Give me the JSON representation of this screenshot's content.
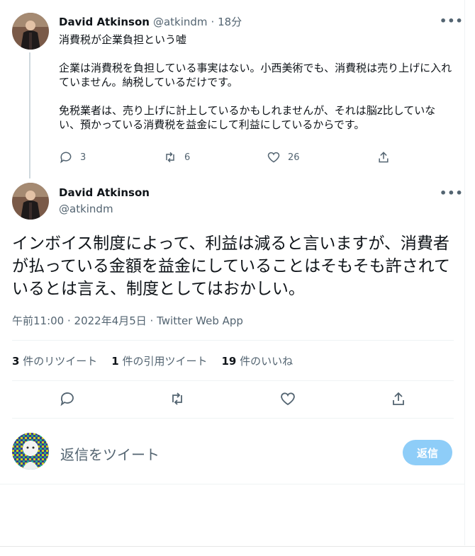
{
  "parent_tweet": {
    "name": "David Atkinson",
    "handle": "@atkindm",
    "time": "· 18分",
    "more": "•••",
    "text": "消費税が企業負担という嘘\n\n企業は消費税を負担している事実はない。小西美術でも、消費税は売り上げに入れていません。納税しているだけです。\n\n免税業者は、売り上げに計上しているかもしれませんが、それは脳z比していない、預かっている消費税を益金にして利益にしているからです。",
    "actions": {
      "reply_count": "3",
      "retweet_count": "6",
      "like_count": "26"
    }
  },
  "main_tweet": {
    "name": "David Atkinson",
    "handle": "@atkindm",
    "more": "•••",
    "text": "インボイス制度によって、利益は減ると言いますが、消費者が払っている金額を益金にしていることはそもそも許されているとは言え、制度としてはおかしい。",
    "meta": "午前11:00 · 2022年4月5日 · Twitter Web App",
    "stats": {
      "retweets_num": "3",
      "retweets_label": "件のリツイート",
      "quotes_num": "1",
      "quotes_label": "件の引用ツイート",
      "likes_num": "19",
      "likes_label": "件のいいね"
    }
  },
  "reply_box": {
    "placeholder": "返信をツイート",
    "button": "返信"
  },
  "colors": {
    "accent": "#1d9bf0",
    "reply_button": "#8ecdf8",
    "muted": "#536471"
  }
}
